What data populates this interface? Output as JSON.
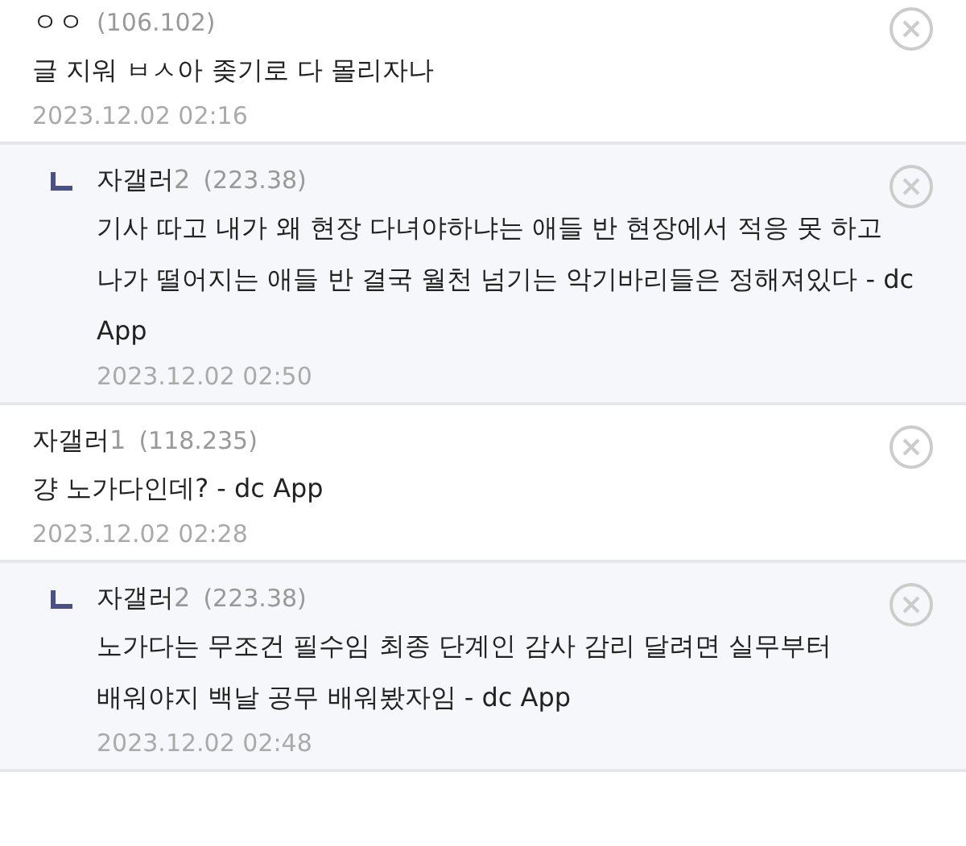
{
  "comments": [
    {
      "kind": "comment",
      "nick": "ㅇㅇ",
      "ip": "(106.102)",
      "text": "글 지워 ㅂㅅ아 좆기로 다 몰리자나",
      "time": "2023.12.02 02:16"
    },
    {
      "kind": "reply",
      "nick": "자갤러",
      "nick_suffix": "2",
      "ip": "(223.38)",
      "text": "기사 따고 내가 왜 현장 다녀야하냐는 애들 반 현장에서 적응 못 하고 나가 떨어지는 애들 반 결국 월천 넘기는 악기바리들은 정해져있다 - dc App",
      "time": "2023.12.02 02:50"
    },
    {
      "kind": "comment",
      "nick": "자갤러",
      "nick_suffix": "1",
      "ip": "(118.235)",
      "text": "걍 노가다인데? - dc App",
      "time": "2023.12.02 02:28"
    },
    {
      "kind": "reply",
      "nick": "자갤러",
      "nick_suffix": "2",
      "ip": "(223.38)",
      "text": "노가다는 무조건 필수임 최종 단계인 감사 감리 달려면 실무부터 배워야지 백날 공무 배워봤자임 - dc App",
      "time": "2023.12.02 02:48"
    }
  ]
}
